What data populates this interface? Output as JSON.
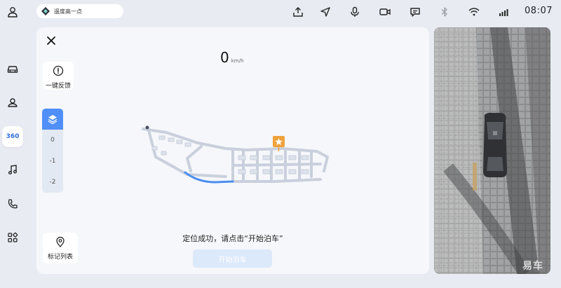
{
  "status_bar": {
    "search_text": "遥度高一点",
    "time": "08:07"
  },
  "rail": {
    "active_label": "360"
  },
  "main": {
    "speed_value": "0",
    "speed_unit": "km/h",
    "feedback_label": "一键反馈",
    "floors": [
      "0",
      "-1",
      "-2"
    ],
    "marker_list_label": "标记列表",
    "hint_text": "定位成功，请点击“开始泊车”",
    "start_button_label": "开始泊车"
  },
  "camera": {
    "watermark": "易车"
  },
  "colors": {
    "accent": "#4f8ff7",
    "route": "#4a8ef0",
    "poi": "#f0a23c"
  }
}
